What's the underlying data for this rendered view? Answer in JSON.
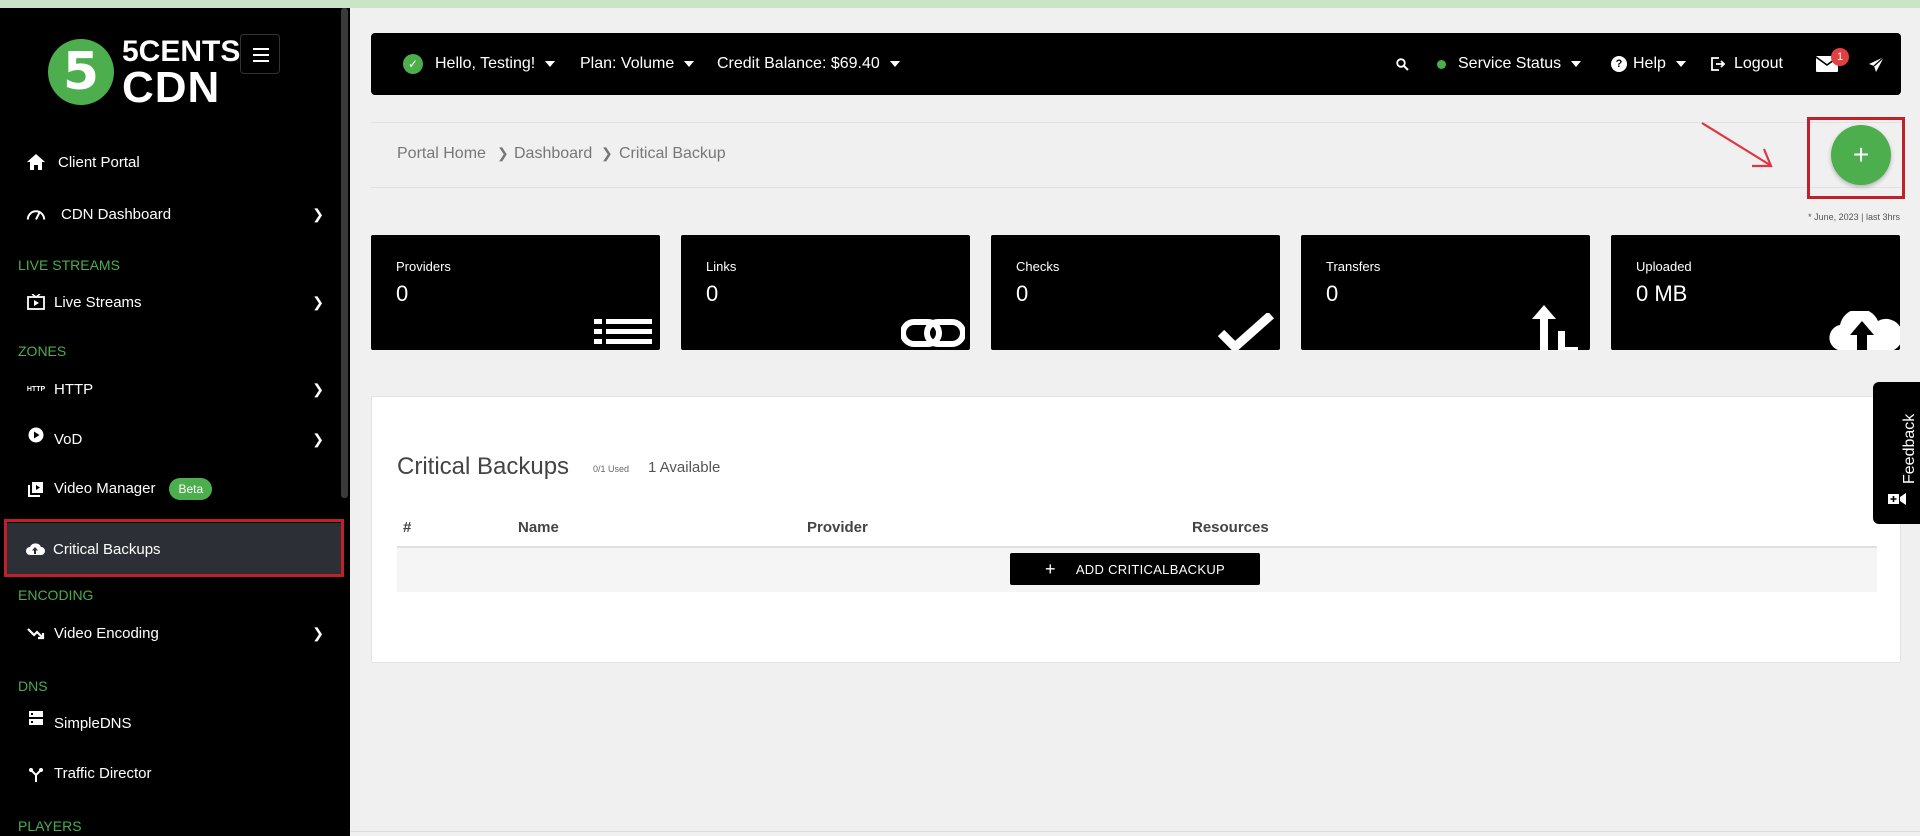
{
  "brand": {
    "logo_number": "5",
    "logo_line1": "5CENTS",
    "logo_line2": "CDN"
  },
  "sidebar": {
    "items": [
      {
        "label": "Client Portal",
        "icon": "home-icon"
      },
      {
        "label": "CDN Dashboard",
        "icon": "speedometer-icon"
      },
      {
        "label": "Live Streams",
        "icon": "tv-play-icon"
      },
      {
        "label": "HTTP",
        "icon": "http-icon",
        "icon_text": "HTTP"
      },
      {
        "label": "VoD",
        "icon": "play-circle-icon"
      },
      {
        "label": "Video Manager",
        "icon": "video-library-icon",
        "badge": "Beta"
      },
      {
        "label": "Critical Backups",
        "icon": "cloud-upload-icon"
      },
      {
        "label": "Video Encoding",
        "icon": "trending-down-icon"
      },
      {
        "label": "SimpleDNS",
        "icon": "server-icon"
      },
      {
        "label": "Traffic Director",
        "icon": "fork-icon"
      }
    ],
    "sections": {
      "live": "LIVE STREAMS",
      "zones": "ZONES",
      "encoding": "ENCODING",
      "dns": "DNS",
      "players": "PLAYERS"
    }
  },
  "topbar": {
    "greeting": "Hello, Testing!",
    "plan": "Plan: Volume",
    "credit": "Credit Balance: $69.40",
    "service_status": "Service Status",
    "help": "Help",
    "logout": "Logout",
    "mail_count": "1"
  },
  "breadcrumb": {
    "home": "Portal Home",
    "dashboard": "Dashboard",
    "current": "Critical Backup"
  },
  "timestamp": "* June, 2023 | last 3hrs",
  "stats": [
    {
      "title": "Providers",
      "value": "0",
      "icon": "list-icon"
    },
    {
      "title": "Links",
      "value": "0",
      "icon": "link-icon"
    },
    {
      "title": "Checks",
      "value": "0",
      "icon": "checkmark-icon"
    },
    {
      "title": "Transfers",
      "value": "0",
      "icon": "transfer-arrows-icon"
    },
    {
      "title": "Uploaded",
      "value": "0 MB",
      "icon": "cloud-upload-icon"
    }
  ],
  "panel": {
    "title": "Critical Backups",
    "used": "0/1 Used",
    "available": "1 Available",
    "columns": [
      "#",
      "Name",
      "Provider",
      "Resources"
    ],
    "add_button": "ADD CRITICALBACKUP",
    "add_button_icon": "plus-icon"
  },
  "feedback_label": "Feedback",
  "colors": {
    "accent": "#4cae4c",
    "highlight": "#c0202a",
    "sidebar_bg": "#000000",
    "active_bg": "#2c2f36",
    "notification": "#e24040"
  }
}
